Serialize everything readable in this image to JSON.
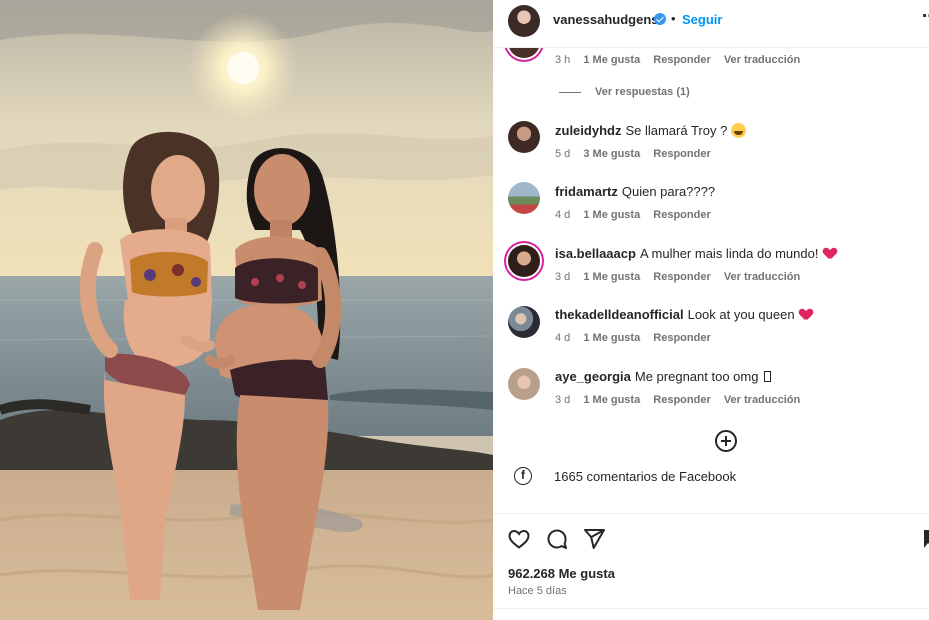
{
  "post": {
    "username": "vanessahudgens",
    "separator": "•",
    "follow_label": "Seguir",
    "more_label": "⋯"
  },
  "comments": [
    {
      "user": "",
      "text": "",
      "time": "3 h",
      "likes": "1 Me gusta",
      "reply": "Responder",
      "translate": "Ver traducción",
      "view_replies": "Ver respuestas (1)"
    },
    {
      "user": "zuleidyhdz",
      "text": "Se llamará Troy ?",
      "time": "5 d",
      "likes": "3 Me gusta",
      "reply": "Responder"
    },
    {
      "user": "fridamartz",
      "text": "Quien para????",
      "time": "4 d",
      "likes": "1 Me gusta",
      "reply": "Responder"
    },
    {
      "user": "isa.bellaaacp",
      "text": "A mulher mais linda do mundo!",
      "time": "3 d",
      "likes": "1 Me gusta",
      "reply": "Responder",
      "translate": "Ver traducción"
    },
    {
      "user": "thekadelldeanofficial",
      "text": "Look at you queen",
      "time": "4 d",
      "likes": "1 Me gusta",
      "reply": "Responder"
    },
    {
      "user": "aye_georgia",
      "text": "Me pregnant too omg",
      "time": "3 d",
      "likes": "1 Me gusta",
      "reply": "Responder",
      "translate": "Ver traducción"
    }
  ],
  "facebook_comments": "1665 comentarios de Facebook",
  "likes_count": "962.268 Me gusta",
  "posted_ago": "Hace 5 días",
  "colors": {
    "follow": "#0095f6",
    "verified": "#3897f0",
    "heart": "#e0245e",
    "meta": "#737373"
  },
  "icons": [
    "verified-badge-icon",
    "crying-emoji-icon",
    "red-heart-icon",
    "add-comment-icon",
    "facebook-icon",
    "heart-icon",
    "comment-icon",
    "share-icon",
    "bookmark-icon"
  ]
}
